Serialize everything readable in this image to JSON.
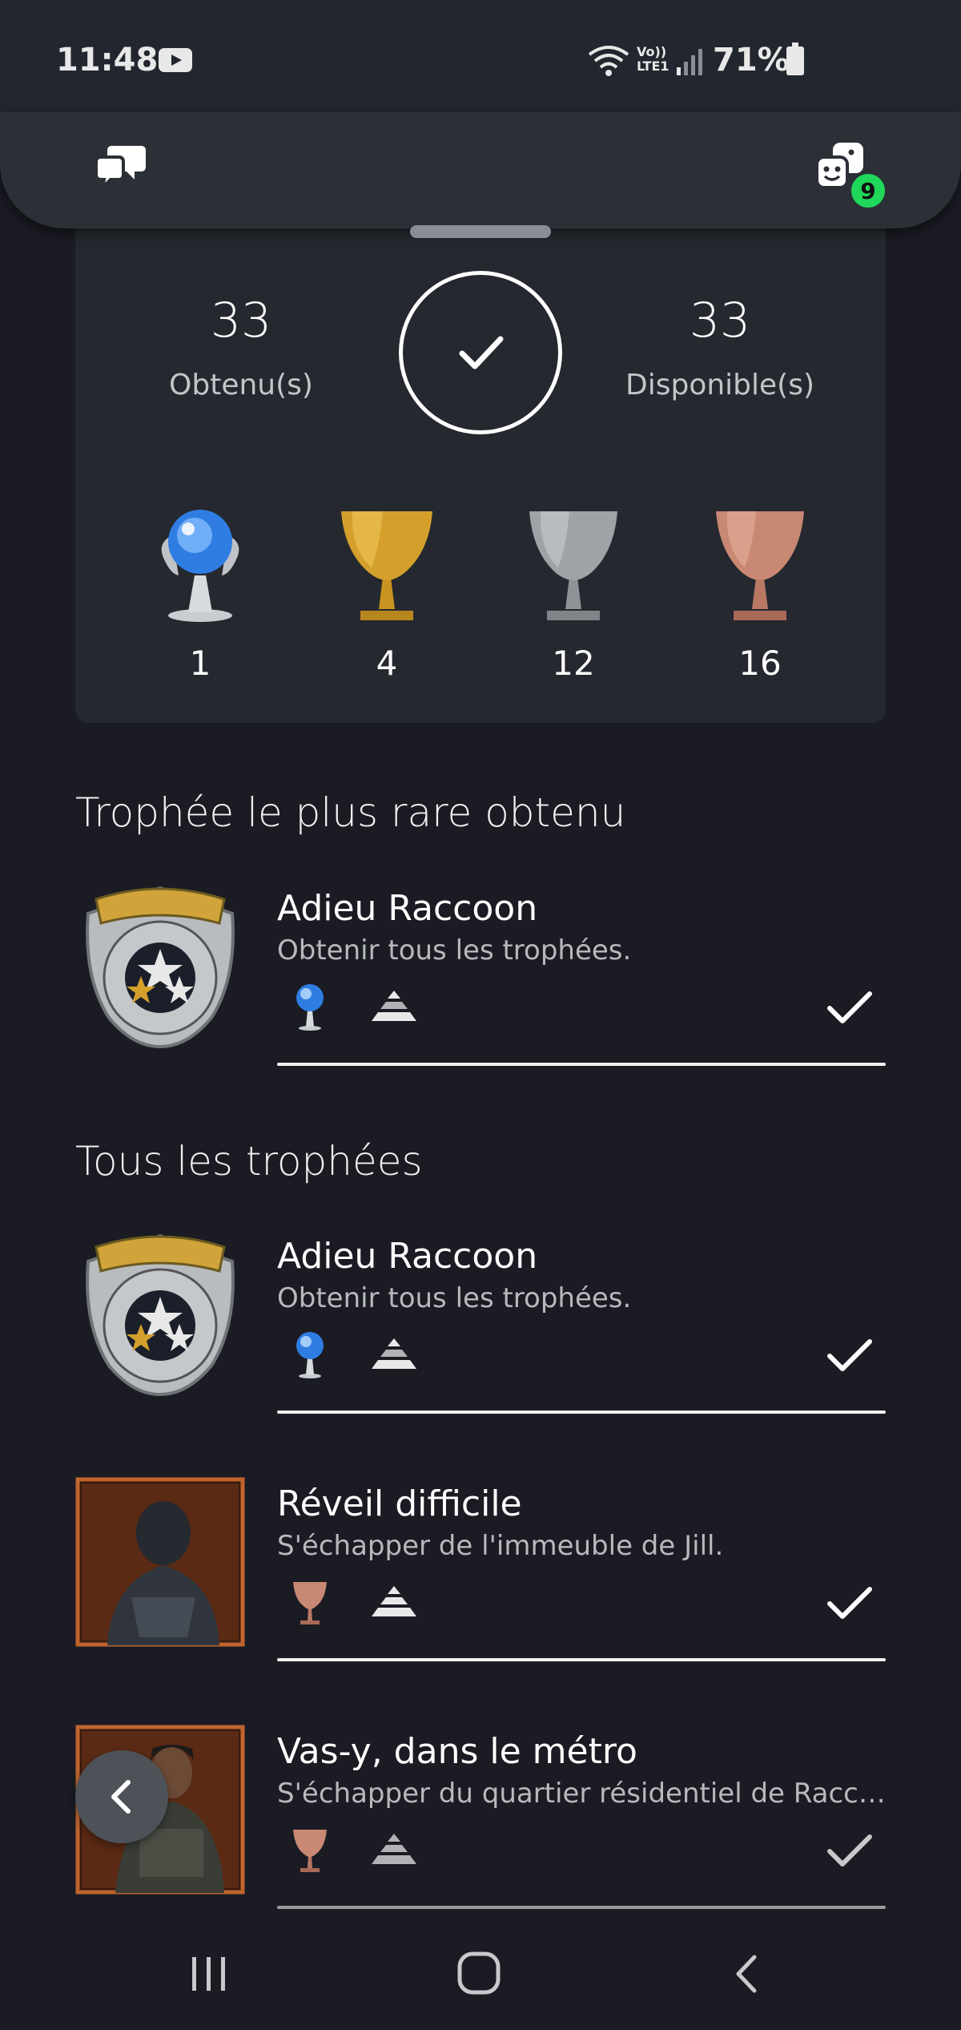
{
  "status_bar": {
    "time": "11:48",
    "volte_line1": "Vo))",
    "volte_line2": "LTE1",
    "battery": "71%"
  },
  "top_bar": {
    "friends_badge": "9"
  },
  "summary": {
    "earned_count": "33",
    "earned_label": "Obtenu(s)",
    "available_count": "33",
    "available_label": "Disponible(s)",
    "trophy_counts": {
      "platinum": "1",
      "gold": "4",
      "silver": "12",
      "bronze": "16"
    }
  },
  "rarest_section": {
    "heading": "Trophée le plus rare obtenu",
    "item": {
      "title": "Adieu Raccoon",
      "description": "Obtenir tous les trophées.",
      "grade": "platinum"
    }
  },
  "all_section": {
    "heading": "Tous les trophées",
    "items": [
      {
        "title": "Adieu Raccoon",
        "description": "Obtenir tous les trophées.",
        "grade": "platinum"
      },
      {
        "title": "Réveil difficile",
        "description": "S'échapper de l'immeuble de Jill.",
        "grade": "bronze"
      },
      {
        "title": "Vas-y, dans le métro",
        "description": "S'échapper du quartier résidentiel de Raccoon City.",
        "grade": "bronze"
      }
    ]
  },
  "colors": {
    "background": "#1a1b23",
    "card": "#25282f",
    "badge": "#1fd85a",
    "gold": "#d4a02b",
    "silver": "#9ea3a8",
    "bronze": "#c88873",
    "platinum": "#5aa3ff"
  },
  "icons": {
    "chat": "chat-bubbles-icon",
    "friends": "friends-faces-icon",
    "complete": "checkmark-icon",
    "rarity": "rarity-pyramid-icon",
    "back": "chevron-left-icon"
  }
}
